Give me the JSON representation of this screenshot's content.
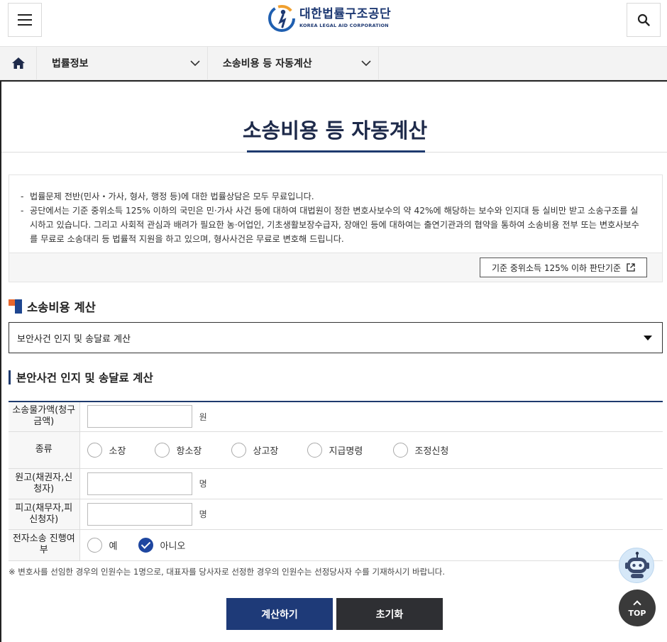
{
  "header": {
    "logo_ko": "대한법률구조공단",
    "logo_en": "KOREA LEGAL AID CORPORATION",
    "menu_icon": "hamburger-menu-icon",
    "search_icon": "search-icon"
  },
  "breadcrumb": {
    "home_icon": "home-icon",
    "items": [
      {
        "label": "법률정보"
      },
      {
        "label": "소송비용 등 자동계산"
      }
    ]
  },
  "page": {
    "title": "소송비용 등 자동계산",
    "notice": [
      "법률문제 전반(민사・가사, 형사, 행정 등)에 대한 법률상담은 모두 무료입니다.",
      "공단에서는 기준 중위소득 125% 이하의 국민은 민·가사 사건 등에 대하여 대법원이 정한 변호사보수의 약 42%에 해당하는 보수와 인지대 등 실비만 받고 소송구조를 실시하고 있습니다. 그리고 사회적 관심과 배려가 필요한 농·어업인, 기초생활보장수급자, 장애인 등에 대하여는 출연기관과의 협약을 통하여 소송비용 전부 또는 변호사보수를 무료로 소송대리 등 법률적 지원을 하고 있으며, 형사사건은 무료로 변호해 드립니다."
    ],
    "criteria_button": "기준 중위소득 125% 이하 판단기준",
    "section_title": "소송비용 계산",
    "select_value": "보안사건 인지 및 송달료 계산",
    "sub_title": "본안사건 인지 및 송달료 계산"
  },
  "form": {
    "amount_label": "소송물가액(청구금액)",
    "amount_value": "",
    "amount_unit": "원",
    "type_label": "종류",
    "type_options": [
      "소장",
      "항소장",
      "상고장",
      "지급명령",
      "조정신청"
    ],
    "plaintiff_label": "원고(채권자,신청자)",
    "plaintiff_value": "",
    "plaintiff_unit": "명",
    "defendant_label": "피고(채무자,피신청자)",
    "defendant_value": "",
    "defendant_unit": "명",
    "electronic_label": "전자소송 진행여부",
    "electronic_options": [
      "예",
      "아니오"
    ],
    "electronic_selected": "아니오"
  },
  "footnote": "※ 변호사를 선임한 경우의 인원수는 1명으로, 대표자를 당사자로 선정한 경우의 인원수는 선정당사자 수를 기재하시기 바랍니다.",
  "buttons": {
    "calculate": "계산하기",
    "reset": "초기화"
  },
  "floating": {
    "chatbot_icon": "chatbot-robot-icon",
    "top_label": "TOP"
  },
  "colors": {
    "primary": "#1e3a78",
    "accent_orange": "#e8672d",
    "dark_button": "#2e2f33"
  }
}
